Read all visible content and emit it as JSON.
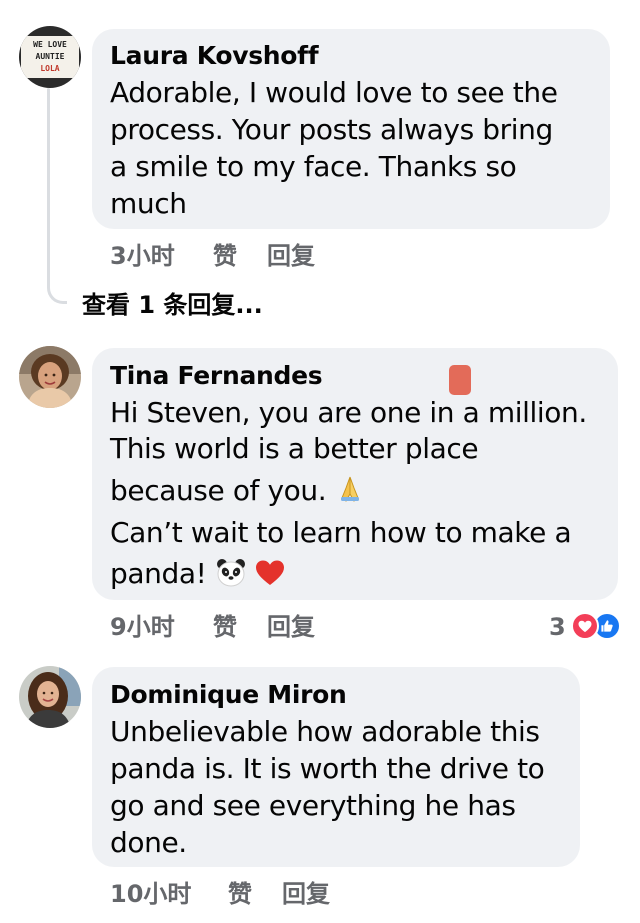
{
  "comments": [
    {
      "author": "Laura Kovshoff",
      "lines": [
        "Adorable, I would love to see the",
        "process.  Your posts always bring",
        "a smile to my face.  Thanks so",
        "much"
      ],
      "time": "3小时",
      "like_label": "赞",
      "reply_label": "回复",
      "avatar": {
        "icon": "letterboard-avatar",
        "text_lines": [
          "WE LOVE",
          "AUNTIE",
          "LOLA"
        ]
      }
    },
    {
      "author": "Tina Fernandes",
      "lines": [
        "Hi Steven, you are one in a million.",
        "This world is a better place",
        "because of you.",
        "Can’t wait to learn how to make a",
        "panda!"
      ],
      "emojis": [
        "folded-hands-icon",
        "panda-face-icon",
        "red-heart-icon"
      ],
      "time": "9小时",
      "like_label": "赞",
      "reply_label": "回复",
      "reaction_count": "3",
      "reactions": [
        "heart-reaction-icon",
        "like-reaction-icon"
      ],
      "avatar": {
        "icon": "photo-avatar"
      }
    },
    {
      "author": "Dominique Miron",
      "lines": [
        "Unbelievable how adorable this",
        "panda is. It is worth the drive to",
        "go and see everything he has",
        "done."
      ],
      "time": "10小时",
      "like_label": "赞",
      "reply_label": "回复",
      "avatar": {
        "icon": "photo-avatar"
      }
    }
  ],
  "view_replies": "查看 1 条回复...",
  "colors": {
    "bubble": "#eff1f4",
    "meta_text": "#65676b",
    "heart_reaction": "#f33e58",
    "like_reaction": "#1877f2"
  }
}
